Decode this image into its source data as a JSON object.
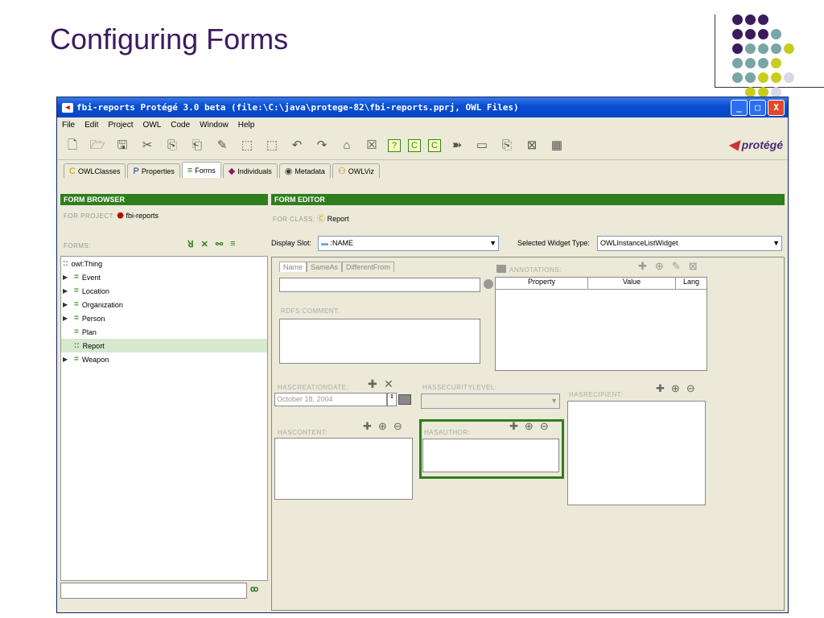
{
  "slide": {
    "title": "Configuring Forms"
  },
  "window": {
    "title": "fbi-reports  Protégé 3.0 beta    (file:\\C:\\java\\protege-82\\fbi-reports.pprj, OWL Files)",
    "app_icon": "protege-icon",
    "buttons": [
      "_",
      "□",
      "X"
    ]
  },
  "menu": [
    "File",
    "Edit",
    "Project",
    "OWL",
    "Code",
    "Window",
    "Help"
  ],
  "logo": "protégé",
  "tabs": [
    {
      "label": "OWLClasses",
      "icon": "C"
    },
    {
      "label": "Properties",
      "icon": "P"
    },
    {
      "label": "Forms",
      "icon": "≡"
    },
    {
      "label": "Individuals",
      "icon": "◆"
    },
    {
      "label": "Metadata",
      "icon": "◉"
    },
    {
      "label": "OWLViz",
      "icon": "⚇"
    }
  ],
  "browser": {
    "header": "FORM BROWSER",
    "for_project_label": "FOR PROJECT:",
    "project": "fbi-reports",
    "forms_label": "FORMS:",
    "tree": [
      {
        "label": "owl:Thing",
        "arrow": false,
        "indent": 0,
        "marker": "::"
      },
      {
        "label": "Event",
        "arrow": true,
        "indent": 1,
        "marker": "="
      },
      {
        "label": "Location",
        "arrow": true,
        "indent": 1,
        "marker": "="
      },
      {
        "label": "Organization",
        "arrow": true,
        "indent": 1,
        "marker": "="
      },
      {
        "label": "Person",
        "arrow": true,
        "indent": 1,
        "marker": "="
      },
      {
        "label": "Plan",
        "arrow": false,
        "indent": 1,
        "marker": "="
      },
      {
        "label": "Report",
        "arrow": false,
        "indent": 1,
        "marker": "::",
        "selected": true
      },
      {
        "label": "Weapon",
        "arrow": true,
        "indent": 1,
        "marker": "="
      }
    ],
    "search_value": ""
  },
  "editor": {
    "header": "FORM EDITOR",
    "for_class_label": "FOR CLASS:",
    "class_name": "Report",
    "display_slot_label": "Display Slot:",
    "display_slot_value": ":NAME",
    "widget_type_label": "Selected Widget Type:",
    "widget_type_value": "OWLInstanceListWidget",
    "name_tabs": [
      "Name",
      "SameAs",
      "DifferentFrom"
    ],
    "rdfs_comment": "RDFS:COMMENT:",
    "annotations_label": "ANNOTATIONS:",
    "annot_columns": [
      "Property",
      "Value",
      "Lang"
    ],
    "hascreationdate": "HASCREATIONDATE:",
    "date_value": "October 18, 2004",
    "hassecuritylevel": "HASSECURITYLEVEL:",
    "hasrecipient": "HASRECIPIENT:",
    "hascontent": "HASCONTENT:",
    "hasauthor": "HASAUTHOR:"
  }
}
